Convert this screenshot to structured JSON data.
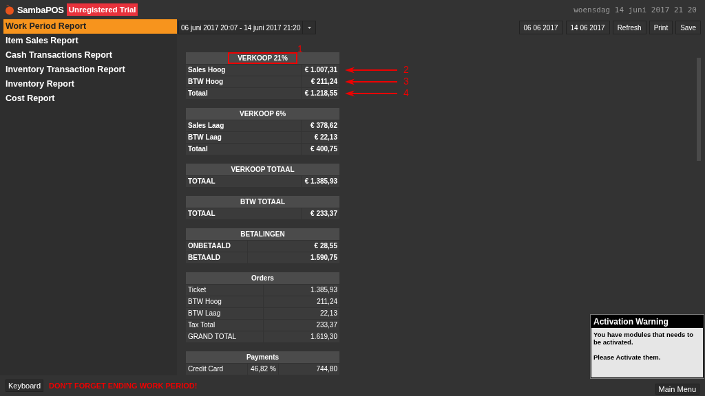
{
  "app": {
    "logo": "SambaPOS",
    "badge": "Unregistered Trial"
  },
  "clock": "woensdag 14 juni 2017 21 20",
  "sidebar": {
    "items": [
      {
        "label": "Work Period Report",
        "selected": true
      },
      {
        "label": "Item Sales Report",
        "selected": false
      },
      {
        "label": "Cash Transactions Report",
        "selected": false
      },
      {
        "label": "Inventory Transaction Report",
        "selected": false
      },
      {
        "label": "Inventory Report",
        "selected": false
      },
      {
        "label": "Cost Report",
        "selected": false
      }
    ]
  },
  "toolbar": {
    "period": "06 juni 2017 20:07 - 14 juni 2017 21:20",
    "start_date": "06 06 2017",
    "end_date": "14 06 2017",
    "buttons": [
      "Refresh",
      "Print",
      "Save"
    ]
  },
  "report": {
    "tables": [
      {
        "title": "VERKOOP 21%",
        "title_marker": "1",
        "kind": "summary",
        "rows": [
          {
            "cells": [
              "Sales Hoog",
              "€ 1.007,31"
            ],
            "marker": "2"
          },
          {
            "cells": [
              "BTW Hoog",
              "€ 211,24"
            ],
            "marker": "3"
          },
          {
            "cells": [
              "Totaal",
              "€ 1.218,55"
            ],
            "marker": "4"
          }
        ]
      },
      {
        "title": "VERKOOP 6%",
        "kind": "summary",
        "rows": [
          {
            "cells": [
              "Sales Laag",
              "€ 378,62"
            ]
          },
          {
            "cells": [
              "BTW Laag",
              "€ 22,13"
            ]
          },
          {
            "cells": [
              "Totaal",
              "€ 400,75"
            ]
          }
        ]
      },
      {
        "title": "VERKOOP TOTAAL",
        "kind": "summary",
        "rows": [
          {
            "cells": [
              "TOTAAL",
              "€ 1.385,93"
            ]
          }
        ]
      },
      {
        "title": "BTW TOTAAL",
        "kind": "summary",
        "rows": [
          {
            "cells": [
              "TOTAAL",
              "€ 233,37"
            ]
          }
        ]
      },
      {
        "title": "BETALINGEN",
        "kind": "payments",
        "rows": [
          {
            "cells": [
              "ONBETAALD",
              "€ 28,55"
            ]
          },
          {
            "cells": [
              "BETAALD",
              "1.590,75"
            ]
          }
        ]
      },
      {
        "title": "Orders",
        "kind": "detail",
        "rows": [
          {
            "cells": [
              "Ticket",
              "1.385,93"
            ]
          },
          {
            "cells": [
              "BTW Hoog",
              "211,24"
            ]
          },
          {
            "cells": [
              "BTW Laag",
              "22,13"
            ]
          },
          {
            "cells": [
              "Tax Total",
              "233,37"
            ]
          },
          {
            "cells": [
              "GRAND TOTAL",
              "1.619,30"
            ]
          }
        ]
      },
      {
        "title": "Payments",
        "kind": "detail",
        "rows": [
          {
            "cells": [
              "Credit Card",
              "46,82 %",
              "744,80"
            ]
          }
        ]
      }
    ]
  },
  "bottom": {
    "keyboard": "Keyboard",
    "warning": "DON'T FORGET ENDING WORK PERIOD!",
    "main_menu": "Main Menu"
  },
  "popup": {
    "title": "Activation Warning",
    "lines": [
      "You have modules that needs to be activated.",
      "Please Activate them."
    ]
  }
}
